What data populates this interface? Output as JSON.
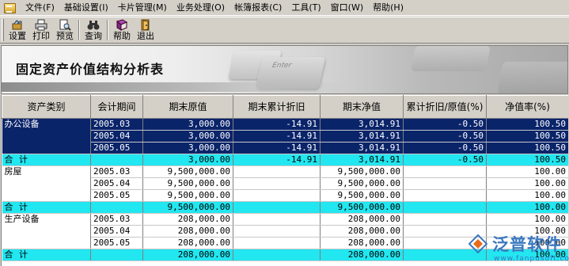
{
  "menu": [
    "文件(F)",
    "基础设置(I)",
    "卡片管理(M)",
    "业务处理(O)",
    "帐簿报表(C)",
    "工具(T)",
    "窗口(W)",
    "帮助(H)"
  ],
  "toolbar": {
    "settings": "设置",
    "print": "打印",
    "preview": "预览",
    "query": "查询",
    "help": "帮助",
    "exit": "退出"
  },
  "banner": {
    "title": "固定资产价值结构分析表",
    "key_label": "Enter"
  },
  "table": {
    "headers": [
      "资产类别",
      "会计期间",
      "期末原值",
      "期末累计折旧",
      "期末净值",
      "累计折旧/原值(%)",
      "净值率(%)"
    ],
    "groups": [
      {
        "category": "办公设备",
        "rows": [
          [
            "2005.03",
            "3,000.00",
            "-14.91",
            "3,014.91",
            "-0.50",
            "100.50"
          ],
          [
            "2005.04",
            "3,000.00",
            "-14.91",
            "3,014.91",
            "-0.50",
            "100.50"
          ],
          [
            "2005.05",
            "3,000.00",
            "-14.91",
            "3,014.91",
            "-0.50",
            "100.50"
          ]
        ],
        "total": {
          "label": "合 计",
          "values": [
            "",
            "3,000.00",
            "-14.91",
            "3,014.91",
            "-0.50",
            "100.50"
          ]
        }
      },
      {
        "category": "房屋",
        "rows": [
          [
            "2005.03",
            "9,500,000.00",
            "",
            "9,500,000.00",
            "",
            "100.00"
          ],
          [
            "2005.04",
            "9,500,000.00",
            "",
            "9,500,000.00",
            "",
            "100.00"
          ],
          [
            "2005.05",
            "9,500,000.00",
            "",
            "9,500,000.00",
            "",
            "100.00"
          ]
        ],
        "total": {
          "label": "合 计",
          "values": [
            "",
            "9,500,000.00",
            "",
            "9,500,000.00",
            "",
            "100.00"
          ]
        }
      },
      {
        "category": "生产设备",
        "rows": [
          [
            "2005.03",
            "208,000.00",
            "",
            "208,000.00",
            "",
            "100.00"
          ],
          [
            "2005.04",
            "208,000.00",
            "",
            "208,000.00",
            "",
            "100.00"
          ],
          [
            "2005.05",
            "208,000.00",
            "",
            "208,000.00",
            "",
            "100.00"
          ]
        ],
        "total": {
          "label": "合 计",
          "values": [
            "",
            "208,000.00",
            "",
            "208,000.00",
            "",
            "100.00"
          ]
        }
      }
    ]
  },
  "watermark": {
    "text": "泛普软件",
    "url": "www.fanpusoft.com"
  },
  "colors": {
    "selection": "#0a246a",
    "total_row": "#22e6f0",
    "chrome": "#d4d0c8",
    "watermark": "#3a78c0"
  }
}
